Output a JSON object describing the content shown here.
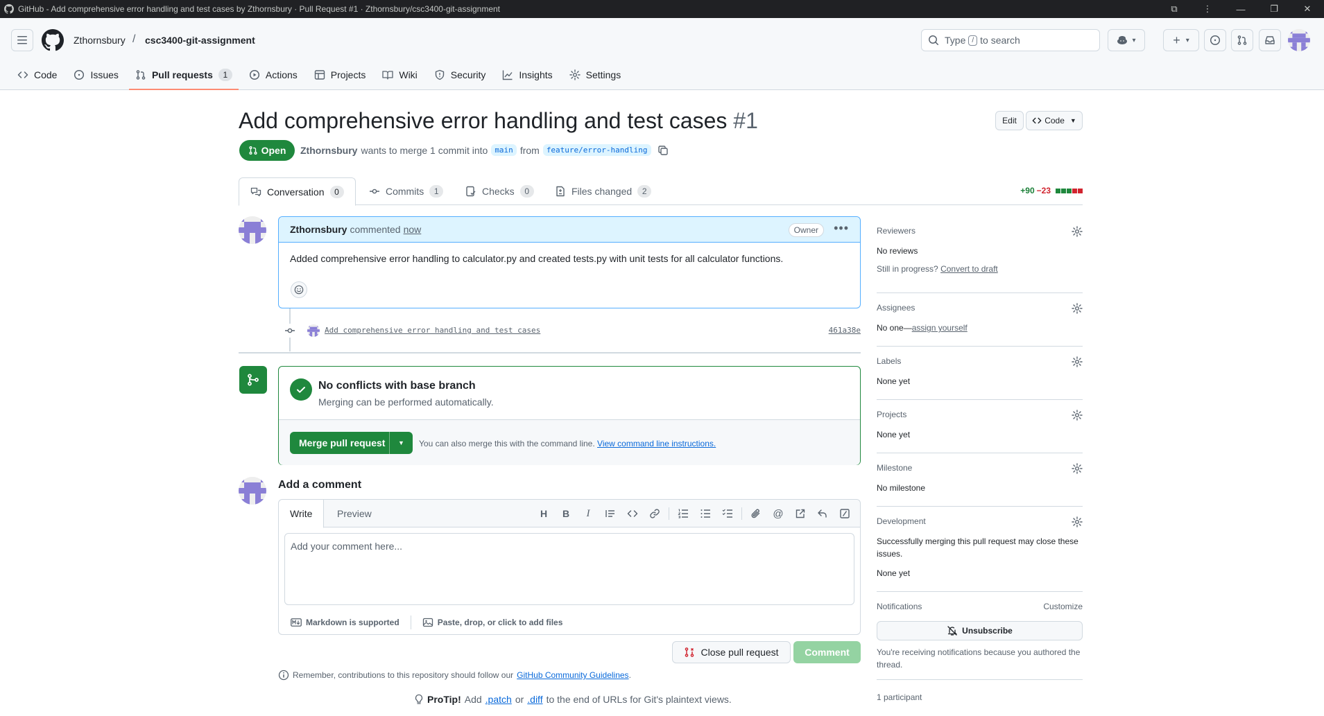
{
  "window": {
    "title": "GitHub - Add comprehensive error handling and test cases by Zthornsbury · Pull Request #1 · Zthornsbury/csc3400-git-assignment"
  },
  "header": {
    "owner": "Zthornsbury",
    "separator": "/",
    "repo": "csc3400-git-assignment",
    "search_prefix": "Type",
    "search_key": "/",
    "search_suffix": "to search"
  },
  "repo_nav": [
    {
      "label": "Code",
      "icon": "code-icon"
    },
    {
      "label": "Issues",
      "icon": "issue-opened-icon"
    },
    {
      "label": "Pull requests",
      "icon": "git-pull-request-icon",
      "count": "1",
      "active": true
    },
    {
      "label": "Actions",
      "icon": "play-icon"
    },
    {
      "label": "Projects",
      "icon": "table-icon"
    },
    {
      "label": "Wiki",
      "icon": "book-icon"
    },
    {
      "label": "Security",
      "icon": "shield-icon"
    },
    {
      "label": "Insights",
      "icon": "graph-icon"
    },
    {
      "label": "Settings",
      "icon": "gear-icon"
    }
  ],
  "pr": {
    "title": "Add comprehensive error handling and test cases",
    "number": "#1",
    "edit_label": "Edit",
    "code_label": "Code",
    "state": "Open",
    "author": "Zthornsbury",
    "meta_middle": "wants to merge 1 commit into",
    "base_branch": "main",
    "meta_from": "from",
    "head_branch": "feature/error-handling"
  },
  "pr_tabs": {
    "conversation": {
      "label": "Conversation",
      "count": "0"
    },
    "commits": {
      "label": "Commits",
      "count": "1"
    },
    "checks": {
      "label": "Checks",
      "count": "0"
    },
    "files": {
      "label": "Files changed",
      "count": "2"
    }
  },
  "diffstat": {
    "additions": "+90",
    "deletions": "−23",
    "blocks": [
      "add",
      "add",
      "add",
      "del",
      "del"
    ]
  },
  "comment": {
    "author": "Zthornsbury",
    "action": "commented",
    "time": "now",
    "badge": "Owner",
    "body": "Added comprehensive error handling to calculator.py and created tests.py with unit tests for all calculator functions."
  },
  "commit": {
    "message": "Add comprehensive error handling and test cases",
    "sha": "461a38e"
  },
  "merge": {
    "title": "No conflicts with base branch",
    "subtitle": "Merging can be performed automatically.",
    "button": "Merge pull request",
    "hint": "You can also merge this with the command line.",
    "hint_link": "View command line instructions."
  },
  "add_comment": {
    "title": "Add a comment",
    "tab_write": "Write",
    "tab_preview": "Preview",
    "placeholder": "Add your comment here...",
    "markdown": "Markdown is supported",
    "attach": "Paste, drop, or click to add files",
    "close_label": "Close pull request",
    "comment_label": "Comment"
  },
  "footer": {
    "guidelines_text": "Remember, contributions to this repository should follow our",
    "guidelines_link": "GitHub Community Guidelines",
    "guidelines_end": ".",
    "protip_label": "ProTip!",
    "protip_add": "Add",
    "protip_patch": ".patch",
    "protip_or": "or",
    "protip_diff": ".diff",
    "protip_end": "to the end of URLs for Git's plaintext views."
  },
  "sidebar": {
    "reviewers": {
      "title": "Reviewers",
      "value": "No reviews",
      "progress_text": "Still in progress?",
      "progress_link": "Convert to draft"
    },
    "assignees": {
      "title": "Assignees",
      "value": "No one—",
      "link": "assign yourself"
    },
    "labels": {
      "title": "Labels",
      "value": "None yet"
    },
    "projects": {
      "title": "Projects",
      "value": "None yet"
    },
    "milestone": {
      "title": "Milestone",
      "value": "No milestone"
    },
    "development": {
      "title": "Development",
      "desc": "Successfully merging this pull request may close these issues.",
      "value": "None yet"
    },
    "notifications": {
      "title": "Notifications",
      "customize": "Customize",
      "button": "Unsubscribe",
      "reason": "You're receiving notifications because you authored the thread."
    },
    "participants": {
      "title": "1 participant"
    }
  },
  "colors": {
    "accent": "#0969da",
    "success": "#1f883d",
    "danger": "#d1242f",
    "tab_underline": "#fd8c73"
  }
}
